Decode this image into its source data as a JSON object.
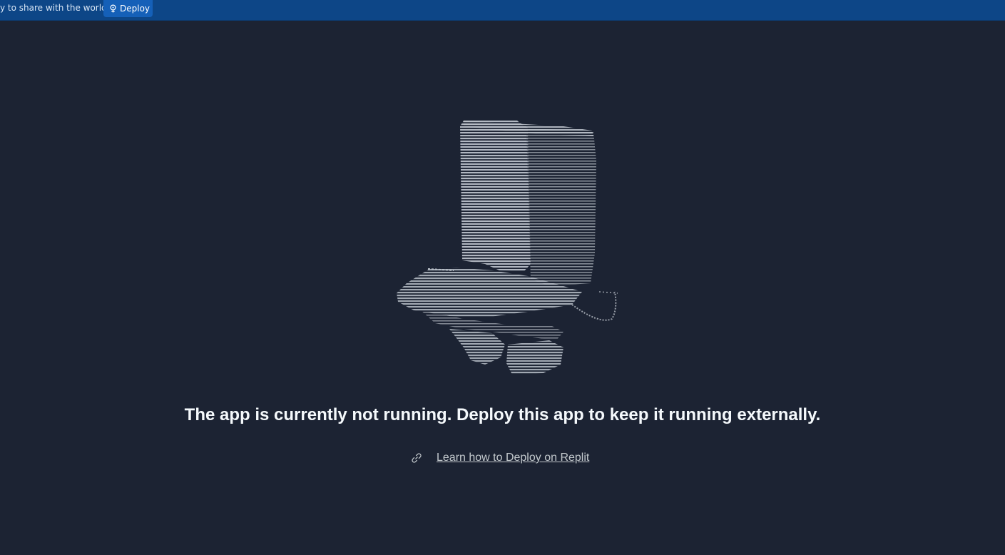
{
  "topbar": {
    "prompt_text": "y to share with the world?",
    "deploy_label": "Deploy",
    "deploy_icon": "deploy-icon"
  },
  "art": {
    "icon": "ascii-art-illustration"
  },
  "main": {
    "headline": "The app is currently not running. Deploy this app to keep it running externally.",
    "learn_link": "Learn how to Deploy on Replit",
    "learn_icon": "link-icon"
  },
  "colors": {
    "background": "#1c2333",
    "topbar": "#0d4687",
    "button": "#1560b8",
    "text": "#f5f9fc",
    "link": "#c2c8cc"
  }
}
